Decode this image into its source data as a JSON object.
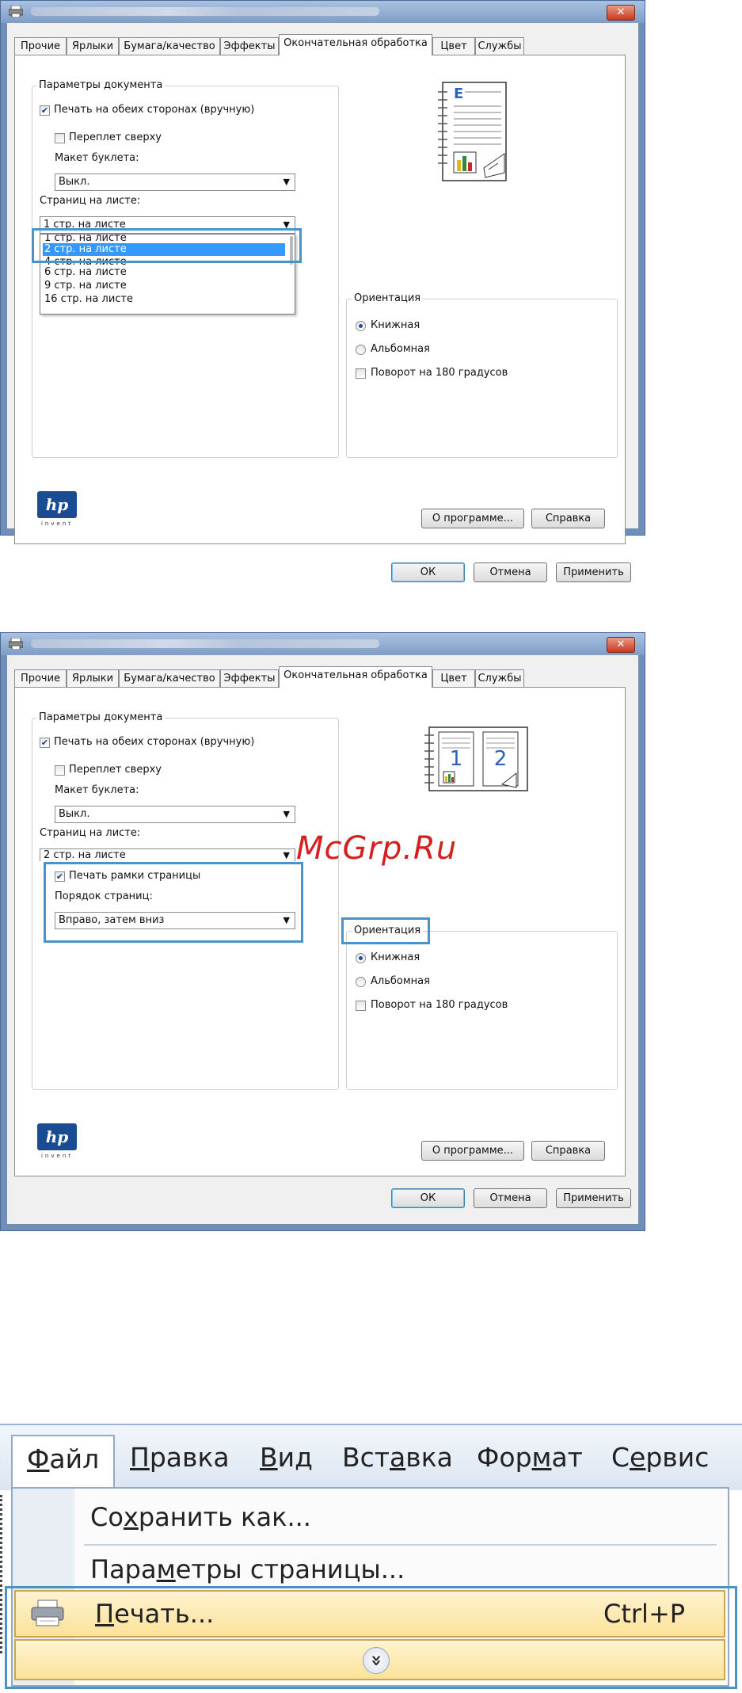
{
  "dialog1": {
    "tabs": [
      "Прочие",
      "Ярлыки",
      "Бумага/качество",
      "Эффекты",
      "Окончательная обработка",
      "Цвет",
      "Службы"
    ],
    "active_tab": "Окончательная обработка",
    "doc_params_legend": "Параметры документа",
    "duplex_label": "Печать на обеих сторонах (вручную)",
    "duplex_checked": true,
    "flip_up_label": "Переплет сверху",
    "flip_up_checked": false,
    "booklet_label": "Макет буклета:",
    "booklet_value": "Выкл.",
    "pages_per_sheet_label": "Страниц на листе:",
    "pages_per_sheet_value": "1 стр. на листе",
    "pages_options": [
      "1 стр. на листе",
      "2 стр. на листе",
      "4 стр. на листе",
      "6 стр. на листе",
      "9 стр. на листе",
      "16 стр. на листе"
    ],
    "selected_option": "2 стр. на листе",
    "orientation_legend": "Ориентация",
    "portrait_label": "Книжная",
    "landscape_label": "Альбомная",
    "rotate_label": "Поворот на 180 градусов",
    "about_button": "О программе...",
    "help_button": "Справка",
    "ok_button": "ОК",
    "cancel_button": "Отмена",
    "apply_button": "Применить",
    "hp_logo_text": "invent"
  },
  "dialog2": {
    "tabs": [
      "Прочие",
      "Ярлыки",
      "Бумага/качество",
      "Эффекты",
      "Окончательная обработка",
      "Цвет",
      "Службы"
    ],
    "active_tab": "Окончательная обработка",
    "doc_params_legend": "Параметры документа",
    "duplex_label": "Печать на обеих сторонах (вручную)",
    "flip_up_label": "Переплет сверху",
    "booklet_label": "Макет буклета:",
    "booklet_value": "Выкл.",
    "pages_per_sheet_label": "Страниц на листе:",
    "pages_per_sheet_value": "2 стр. на листе",
    "print_borders_label": "Печать рамки страницы",
    "print_borders_checked": true,
    "page_order_label": "Порядок страниц:",
    "page_order_value": "Вправо, затем вниз",
    "orientation_legend": "Ориентация",
    "portrait_label": "Книжная",
    "landscape_label": "Альбомная",
    "rotate_label": "Поворот на 180 градусов",
    "about_button": "О программе...",
    "help_button": "Справка",
    "ok_button": "ОК",
    "cancel_button": "Отмена",
    "apply_button": "Применить",
    "hp_logo_text": "invent",
    "preview_page_numbers": [
      "1",
      "2"
    ]
  },
  "watermark": "McGrp.Ru",
  "menu": {
    "bar": [
      {
        "pre": "",
        "u": "Ф",
        "post": "айл"
      },
      {
        "pre": "",
        "u": "П",
        "post": "равка"
      },
      {
        "pre": "",
        "u": "В",
        "post": "ид"
      },
      {
        "pre": "Вст",
        "u": "а",
        "post": "вка"
      },
      {
        "pre": "Фор",
        "u": "м",
        "post": "ат"
      },
      {
        "pre": "С",
        "u": "е",
        "post": "рвис"
      }
    ],
    "save_as": {
      "pre": "Со",
      "u": "х",
      "post": "ранить как..."
    },
    "page_setup": {
      "pre": "Пара",
      "u": "м",
      "post": "етры страницы..."
    },
    "print": {
      "pre": "",
      "u": "П",
      "post": "ечать..."
    },
    "print_shortcut": "Ctrl+P",
    "expand_glyph": "»"
  },
  "colors": {
    "highlight_box": "#4a93c9",
    "selection": "#3399ff",
    "menu_hover": "#fbe29a",
    "watermark": "#d61f1f"
  }
}
